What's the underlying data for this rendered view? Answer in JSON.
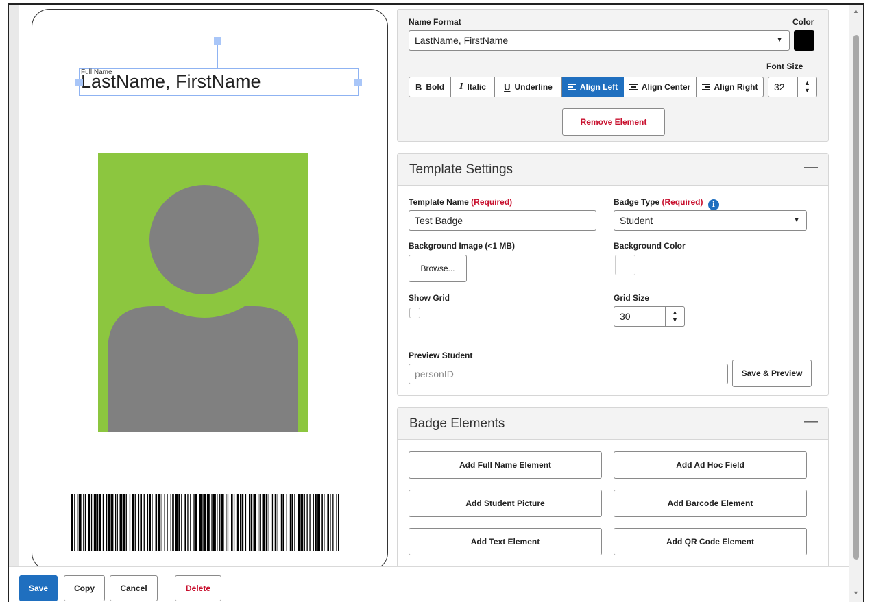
{
  "badge_preview": {
    "element_tag": "Full Name",
    "name_text": "LastName, FirstName"
  },
  "name_format": {
    "label": "Name Format",
    "value": "LastName, FirstName",
    "color_label": "Color",
    "color_value": "#000000",
    "font_size_label": "Font Size",
    "font_size": "32",
    "buttons": {
      "bold": "Bold",
      "italic": "Italic",
      "underline": "Underline",
      "align_left": "Align Left",
      "align_center": "Align Center",
      "align_right": "Align Right"
    },
    "remove_label": "Remove Element"
  },
  "template_settings": {
    "title": "Template Settings",
    "template_name_label": "Template Name",
    "required_tag": "(Required)",
    "template_name_value": "Test Badge",
    "badge_type_label": "Badge Type",
    "badge_type_value": "Student",
    "background_image_label": "Background Image (<1 MB)",
    "browse_label": "Browse...",
    "background_color_label": "Background Color",
    "show_grid_label": "Show Grid",
    "grid_size_label": "Grid Size",
    "grid_size_value": "30",
    "preview_student_label": "Preview Student",
    "preview_placeholder": "personID",
    "save_preview_label": "Save & Preview"
  },
  "badge_elements": {
    "title": "Badge Elements",
    "buttons": [
      "Add Full Name Element",
      "Add Ad Hoc Field",
      "Add Student Picture",
      "Add Barcode Element",
      "Add Text Element",
      "Add QR Code Element"
    ]
  },
  "actions": {
    "save": "Save",
    "copy": "Copy",
    "cancel": "Cancel",
    "delete": "Delete"
  },
  "colors": {
    "accent": "#1f6fbf",
    "danger": "#c8102e",
    "photo_bg": "#8cc63f",
    "silhouette": "#808080"
  }
}
